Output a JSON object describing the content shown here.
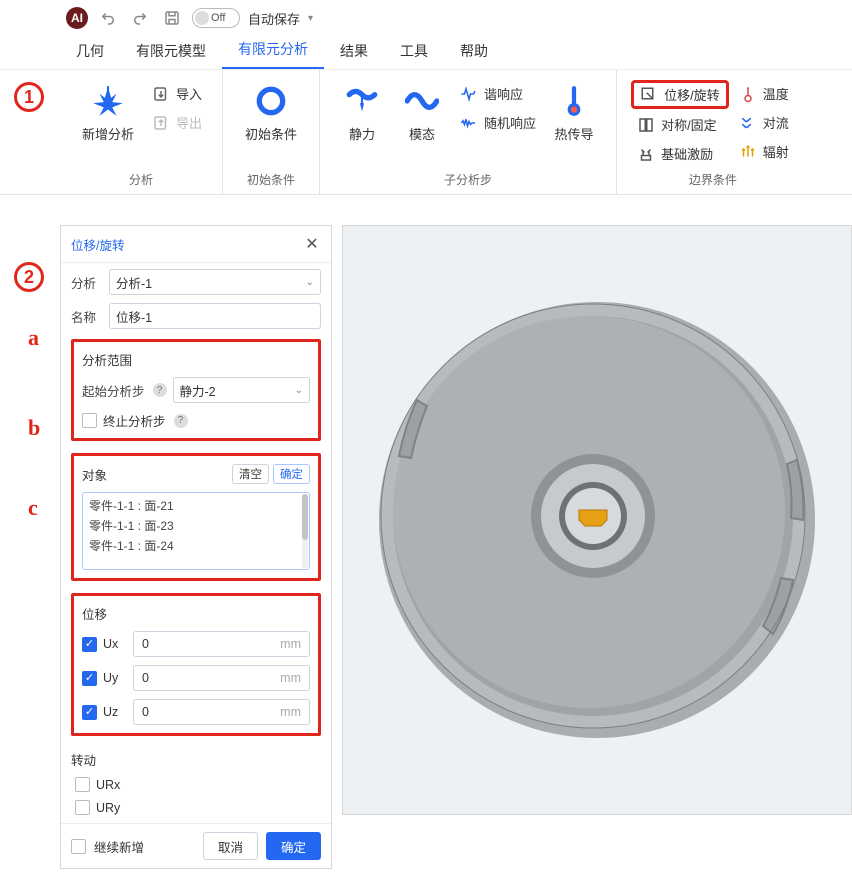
{
  "titlebar": {
    "toggle_label": "Off",
    "autosave_label": "自动保存"
  },
  "menu": {
    "items": [
      "几何",
      "有限元模型",
      "有限元分析",
      "结果",
      "工具",
      "帮助"
    ],
    "active_index": 2
  },
  "ribbon": {
    "groups": {
      "analysis": {
        "title": "分析",
        "new_analysis": "新增分析",
        "import": "导入",
        "export": "导出"
      },
      "initial": {
        "title": "初始条件",
        "initial_conditions": "初始条件"
      },
      "substep": {
        "title": "子分析步",
        "static": "静力",
        "modal": "模态",
        "harmonic": "谐响应",
        "random": "随机响应",
        "thermal": "热传导"
      },
      "boundary": {
        "title": "边界条件",
        "disp_rot": "位移/旋转",
        "symm_fix": "对称/固定",
        "base_excite": "基础激励",
        "temperature": "温度",
        "convection": "对流",
        "radiation": "辐射"
      }
    }
  },
  "panel": {
    "title": "位移/旋转",
    "analysis_label": "分析",
    "analysis_value": "分析-1",
    "name_label": "名称",
    "name_value": "位移-1",
    "scope": {
      "title": "分析范围",
      "start_label": "起始分析步",
      "start_value": "静力-2",
      "end_label": "终止分析步"
    },
    "objects": {
      "title": "对象",
      "clear": "清空",
      "ok": "确定",
      "items": [
        "零件-1-1 : 面-21",
        "零件-1-1 : 面-23",
        "零件-1-1 : 面-24"
      ]
    },
    "disp": {
      "title": "位移",
      "ux_label": "Ux",
      "uy_label": "Uy",
      "uz_label": "Uz",
      "ux_val": "0",
      "uy_val": "0",
      "uz_val": "0",
      "unit": "mm"
    },
    "rot": {
      "title": "转动",
      "urx_label": "URx",
      "ury_label": "URy"
    },
    "footer": {
      "continue_add": "继续新增",
      "cancel": "取消",
      "ok": "确定"
    }
  },
  "annotations": {
    "one": "1",
    "two": "2",
    "a": "a",
    "b": "b",
    "c": "c"
  }
}
